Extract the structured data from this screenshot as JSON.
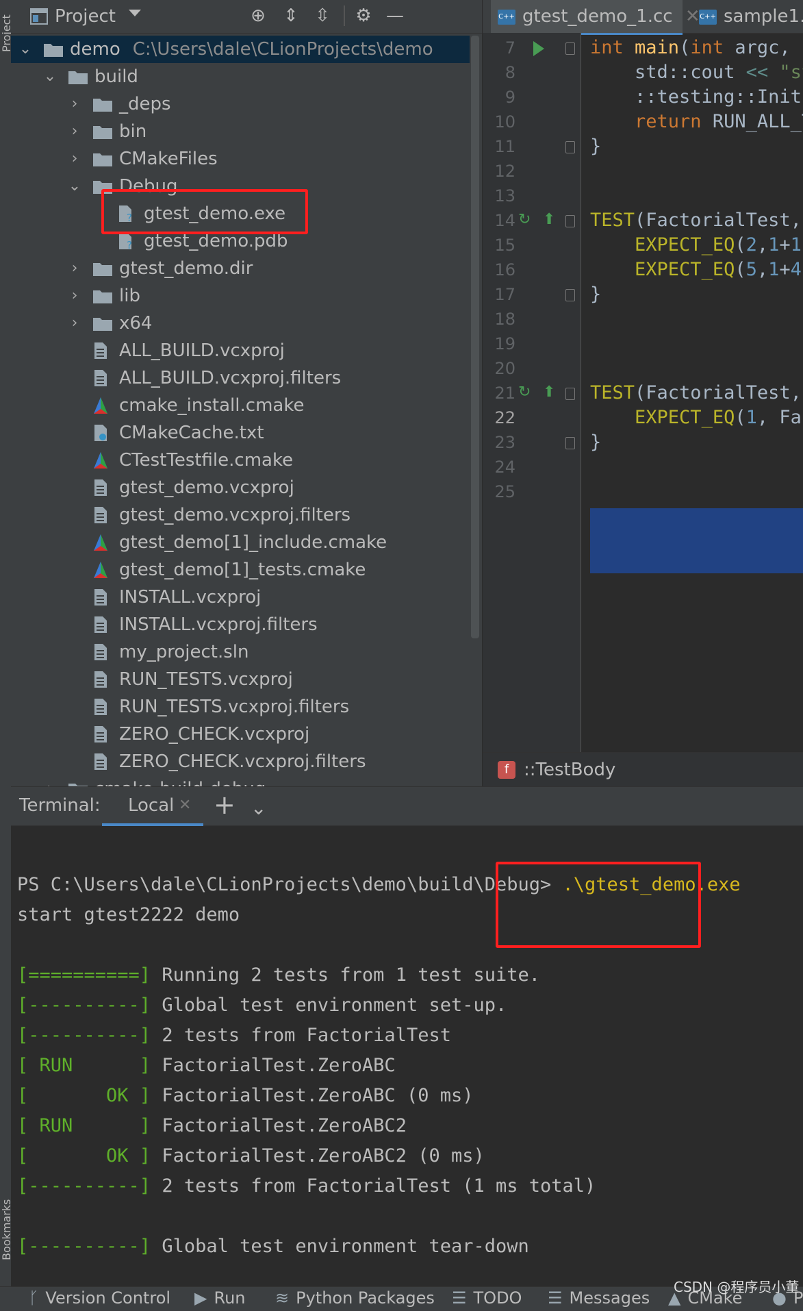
{
  "project_panel": {
    "title": "Project",
    "root": {
      "name": "demo",
      "path": "C:\\Users\\dale\\CLionProjects\\demo"
    },
    "tree": [
      {
        "name": "build",
        "kind": "folder",
        "state": "open",
        "depth": 1
      },
      {
        "name": "_deps",
        "kind": "folder",
        "state": "closed",
        "depth": 2
      },
      {
        "name": "bin",
        "kind": "folder",
        "state": "closed",
        "depth": 2
      },
      {
        "name": "CMakeFiles",
        "kind": "folder",
        "state": "closed",
        "depth": 2
      },
      {
        "name": "Debug",
        "kind": "folder",
        "state": "open",
        "depth": 2
      },
      {
        "name": "gtest_demo.exe",
        "kind": "unknown-file",
        "depth": 3
      },
      {
        "name": "gtest_demo.pdb",
        "kind": "unknown-file",
        "depth": 3
      },
      {
        "name": "gtest_demo.dir",
        "kind": "folder",
        "state": "closed",
        "depth": 2
      },
      {
        "name": "lib",
        "kind": "folder",
        "state": "closed",
        "depth": 2
      },
      {
        "name": "x64",
        "kind": "folder",
        "state": "closed",
        "depth": 2
      },
      {
        "name": "ALL_BUILD.vcxproj",
        "kind": "text-file",
        "depth": 2
      },
      {
        "name": "ALL_BUILD.vcxproj.filters",
        "kind": "text-file",
        "depth": 2
      },
      {
        "name": "cmake_install.cmake",
        "kind": "cmake-file",
        "depth": 2
      },
      {
        "name": "CMakeCache.txt",
        "kind": "cmake-cache-file",
        "depth": 2
      },
      {
        "name": "CTestTestfile.cmake",
        "kind": "cmake-file",
        "depth": 2
      },
      {
        "name": "gtest_demo.vcxproj",
        "kind": "text-file",
        "depth": 2
      },
      {
        "name": "gtest_demo.vcxproj.filters",
        "kind": "text-file",
        "depth": 2
      },
      {
        "name": "gtest_demo[1]_include.cmake",
        "kind": "cmake-file",
        "depth": 2
      },
      {
        "name": "gtest_demo[1]_tests.cmake",
        "kind": "cmake-file",
        "depth": 2
      },
      {
        "name": "INSTALL.vcxproj",
        "kind": "text-file",
        "depth": 2
      },
      {
        "name": "INSTALL.vcxproj.filters",
        "kind": "text-file",
        "depth": 2
      },
      {
        "name": "my_project.sln",
        "kind": "text-file",
        "depth": 2
      },
      {
        "name": "RUN_TESTS.vcxproj",
        "kind": "text-file",
        "depth": 2
      },
      {
        "name": "RUN_TESTS.vcxproj.filters",
        "kind": "text-file",
        "depth": 2
      },
      {
        "name": "ZERO_CHECK.vcxproj",
        "kind": "text-file",
        "depth": 2
      },
      {
        "name": "ZERO_CHECK.vcxproj.filters",
        "kind": "text-file",
        "depth": 2
      },
      {
        "name": "cmake-build-debug",
        "kind": "folder",
        "state": "closed",
        "depth": 1
      }
    ]
  },
  "editor": {
    "tabs": [
      {
        "label": "gtest_demo_1.cc",
        "active": true
      },
      {
        "label": "sample1.cc",
        "active": false
      }
    ],
    "current_line": 22,
    "lines": [
      {
        "n": 7,
        "run": "run-arrow",
        "parts": [
          {
            "t": "int ",
            "c": "kw"
          },
          {
            "t": "main",
            "c": "fn"
          },
          {
            "t": "(",
            "c": ""
          },
          {
            "t": "int ",
            "c": "kw"
          },
          {
            "t": "argc, c",
            "c": ""
          }
        ]
      },
      {
        "n": 8,
        "parts": [
          {
            "t": "    std::cout ",
            "c": ""
          },
          {
            "t": "<< ",
            "c": "op"
          },
          {
            "t": "\"st",
            "c": "str"
          }
        ]
      },
      {
        "n": 9,
        "parts": [
          {
            "t": "    ::testing::Init(",
            "c": ""
          }
        ]
      },
      {
        "n": 10,
        "parts": [
          {
            "t": "    ",
            "c": ""
          },
          {
            "t": "return ",
            "c": "kw"
          },
          {
            "t": "RUN_ALL_T",
            "c": ""
          }
        ]
      },
      {
        "n": 11,
        "parts": [
          {
            "t": "}",
            "c": ""
          }
        ]
      },
      {
        "n": 12,
        "parts": []
      },
      {
        "n": 13,
        "parts": []
      },
      {
        "n": 14,
        "run": "test-run",
        "parts": [
          {
            "t": "TEST",
            "c": "mac"
          },
          {
            "t": "(FactorialTest,",
            "c": ""
          }
        ]
      },
      {
        "n": 15,
        "parts": [
          {
            "t": "    ",
            "c": ""
          },
          {
            "t": "EXPECT_EQ",
            "c": "mac"
          },
          {
            "t": "(",
            "c": ""
          },
          {
            "t": "2",
            "c": "num"
          },
          {
            "t": ",",
            "c": ""
          },
          {
            "t": "1",
            "c": "num"
          },
          {
            "t": "+",
            "c": ""
          },
          {
            "t": "1",
            "c": "num"
          },
          {
            "t": ")",
            "c": ""
          }
        ]
      },
      {
        "n": 16,
        "parts": [
          {
            "t": "    ",
            "c": ""
          },
          {
            "t": "EXPECT_EQ",
            "c": "mac"
          },
          {
            "t": "(",
            "c": ""
          },
          {
            "t": "5",
            "c": "num"
          },
          {
            "t": ",",
            "c": ""
          },
          {
            "t": "1",
            "c": "num"
          },
          {
            "t": "+",
            "c": ""
          },
          {
            "t": "4",
            "c": "num"
          },
          {
            "t": ")",
            "c": ""
          }
        ]
      },
      {
        "n": 17,
        "parts": [
          {
            "t": "}",
            "c": ""
          }
        ]
      },
      {
        "n": 18,
        "parts": []
      },
      {
        "n": 19,
        "parts": []
      },
      {
        "n": 20,
        "parts": []
      },
      {
        "n": 21,
        "run": "test-run",
        "parts": [
          {
            "t": "TEST",
            "c": "mac"
          },
          {
            "t": "(FactorialTest,",
            "c": ""
          }
        ]
      },
      {
        "n": 22,
        "parts": [
          {
            "t": "    ",
            "c": ""
          },
          {
            "t": "EXPECT_EQ",
            "c": "mac"
          },
          {
            "t": "(",
            "c": ""
          },
          {
            "t": "1",
            "c": "num"
          },
          {
            "t": ", Fac",
            "c": ""
          }
        ]
      },
      {
        "n": 23,
        "parts": [
          {
            "t": "}",
            "c": ""
          }
        ]
      },
      {
        "n": 24,
        "parts": []
      },
      {
        "n": 25,
        "parts": []
      }
    ],
    "breadcrumb": "::TestBody",
    "breadcrumb_badge": "f"
  },
  "terminal": {
    "label": "Terminal:",
    "tab": "Local",
    "lines": [
      {
        "parts": []
      },
      {
        "parts": [
          {
            "t": "PS C:\\Users\\dale\\CLionProjects\\demo\\build\\Debug> ",
            "c": ""
          },
          {
            "t": ".\\gtest_demo.exe",
            "c": "yellow"
          }
        ]
      },
      {
        "parts": [
          {
            "t": "start gtest2222 demo",
            "c": ""
          }
        ]
      },
      {
        "parts": []
      },
      {
        "parts": [
          {
            "t": "[==========] ",
            "c": "green"
          },
          {
            "t": "Running 2 tests from 1 test suite.",
            "c": ""
          }
        ]
      },
      {
        "parts": [
          {
            "t": "[----------] ",
            "c": "green"
          },
          {
            "t": "Global test environment set-up.",
            "c": ""
          }
        ]
      },
      {
        "parts": [
          {
            "t": "[----------] ",
            "c": "green"
          },
          {
            "t": "2 tests from FactorialTest",
            "c": ""
          }
        ]
      },
      {
        "parts": [
          {
            "t": "[ RUN      ] ",
            "c": "green"
          },
          {
            "t": "FactorialTest.ZeroABC",
            "c": ""
          }
        ]
      },
      {
        "parts": [
          {
            "t": "[       OK ] ",
            "c": "green"
          },
          {
            "t": "FactorialTest.ZeroABC (0 ms)",
            "c": ""
          }
        ]
      },
      {
        "parts": [
          {
            "t": "[ RUN      ] ",
            "c": "green"
          },
          {
            "t": "FactorialTest.ZeroABC2",
            "c": ""
          }
        ]
      },
      {
        "parts": [
          {
            "t": "[       OK ] ",
            "c": "green"
          },
          {
            "t": "FactorialTest.ZeroABC2 (0 ms)",
            "c": ""
          }
        ]
      },
      {
        "parts": [
          {
            "t": "[----------] ",
            "c": "green"
          },
          {
            "t": "2 tests from FactorialTest (1 ms total)",
            "c": ""
          }
        ]
      },
      {
        "parts": []
      },
      {
        "parts": [
          {
            "t": "[----------] ",
            "c": "green"
          },
          {
            "t": "Global test environment tear-down",
            "c": ""
          }
        ]
      }
    ]
  },
  "side_tabs": {
    "top": "Project",
    "bottom": "Bookmarks"
  },
  "status_bar": {
    "items": [
      {
        "label": "Version Control",
        "icon": "branch-icon"
      },
      {
        "label": "Run",
        "icon": "play-icon"
      },
      {
        "label": "Python Packages",
        "icon": "layers-icon"
      },
      {
        "label": "TODO",
        "icon": "list-icon"
      },
      {
        "label": "Messages",
        "icon": "messages-icon"
      },
      {
        "label": "CMake",
        "icon": "cmake-icon"
      },
      {
        "label": "P",
        "icon": "problems-icon"
      }
    ],
    "watermark": "CSDN @程序员小董"
  },
  "colors": {
    "highlight_box": "#ff1f1f",
    "selection": "#214283",
    "accent": "#4a88c7"
  }
}
